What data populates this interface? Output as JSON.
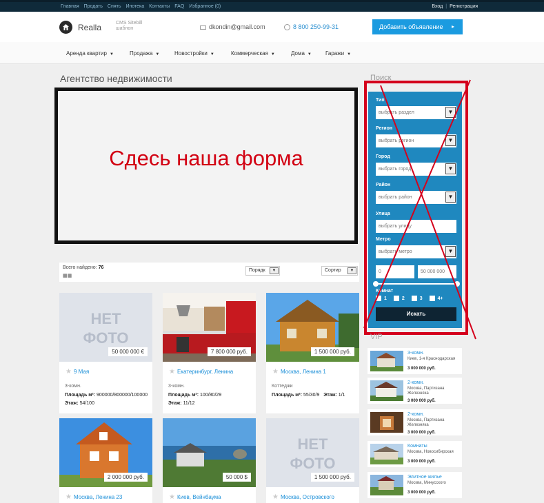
{
  "topbar": {
    "links": [
      "Главная",
      "Продать",
      "Снять",
      "Ипотека",
      "Контакты",
      "FAQ",
      "Избранное (0)"
    ],
    "login": "Вход",
    "register": "Регистрация"
  },
  "header": {
    "logo_name": "Realla",
    "logo_sub": "CMS Sitebill шаблон",
    "email": "dkondin@gmail.com",
    "phone": "8 800 250-99-31",
    "add_button": "Добавить объявление"
  },
  "nav": [
    "Аренда квартир",
    "Продажа",
    "Новостройки",
    "Коммерческая",
    "Дома",
    "Гаражи"
  ],
  "page_title": "Агентство недвижимости",
  "form_placeholder_note": "Сдесь наша форма",
  "results": {
    "found_label": "Всего найдено:",
    "found_count": "76",
    "order_label": "Порядк",
    "sort_label": "Сортир"
  },
  "listings": [
    {
      "price": "50 000 000 €",
      "title": "9 Мая",
      "type": "3-комн.",
      "area_label": "Площадь м²:",
      "area": "900000/800000/100000",
      "floor_label": "Этаж:",
      "floor": "54/100",
      "photo": "none"
    },
    {
      "price": "7 800 000 руб.",
      "title": "Екатеринбург, Ленина",
      "type": "3-комн.",
      "area_label": "Площадь м²:",
      "area": "100/80/29",
      "floor_label": "Этаж:",
      "floor": "11/12",
      "photo": "kitchen"
    },
    {
      "price": "1 500 000 руб.",
      "title": "Москва, Ленина 1",
      "type": "Коттеджи",
      "area_label": "Площадь м²:",
      "area": "55/30/9",
      "floor_label": "Этаж:",
      "floor": "1/1",
      "photo": "wood-house"
    },
    {
      "price": "2 000 000 руб.",
      "title": "Москва, Ленина 23",
      "photo": "brick-house"
    },
    {
      "price": "50 000 $",
      "title": "Киев, Вейнбаума",
      "photo": "sea-house"
    },
    {
      "price": "1 500 000 руб.",
      "title": "Москва, Островского",
      "photo": "none"
    }
  ],
  "no_photo_text": [
    "НЕТ",
    "ФОТО"
  ],
  "search": {
    "title": "Поиск",
    "type_label": "Тип",
    "type_value": "выбрать раздел",
    "region_label": "Регион",
    "region_value": "выбрать регион",
    "city_label": "Город",
    "city_value": "выбрать город",
    "district_label": "Район",
    "district_value": "выбрать район",
    "street_label": "Улица",
    "street_placeholder": "выбрать улицу",
    "metro_label": "Метро",
    "metro_value": "выбрать метро",
    "price_min": "0",
    "price_max": "50 000 000",
    "rooms_label": "Комнат",
    "rooms": [
      "1",
      "2",
      "3",
      "4+"
    ],
    "submit": "Искать"
  },
  "vip": {
    "title": "VIP",
    "items": [
      {
        "title": "3-комн.",
        "address": "Киев, 1-я Краснодарская",
        "price": "3 000 000 руб."
      },
      {
        "title": "2-комн.",
        "address": "Москва, Партизана Железняка",
        "price": "3 000 000 руб."
      },
      {
        "title": "2-комн.",
        "address": "Москва, Партизана Железняка",
        "price": "3 000 000 руб."
      },
      {
        "title": "Комнаты",
        "address": "Москва, Новосибирская",
        "price": "3 000 000 руб."
      },
      {
        "title": "Элитное жилье",
        "address": "Москва, Минусского",
        "price": "3 000 000 руб."
      }
    ]
  },
  "colors": {
    "accent": "#1b9be0",
    "panel": "#1f88bf",
    "annotation": "#d4001c",
    "dark": "#0f2a3a"
  }
}
